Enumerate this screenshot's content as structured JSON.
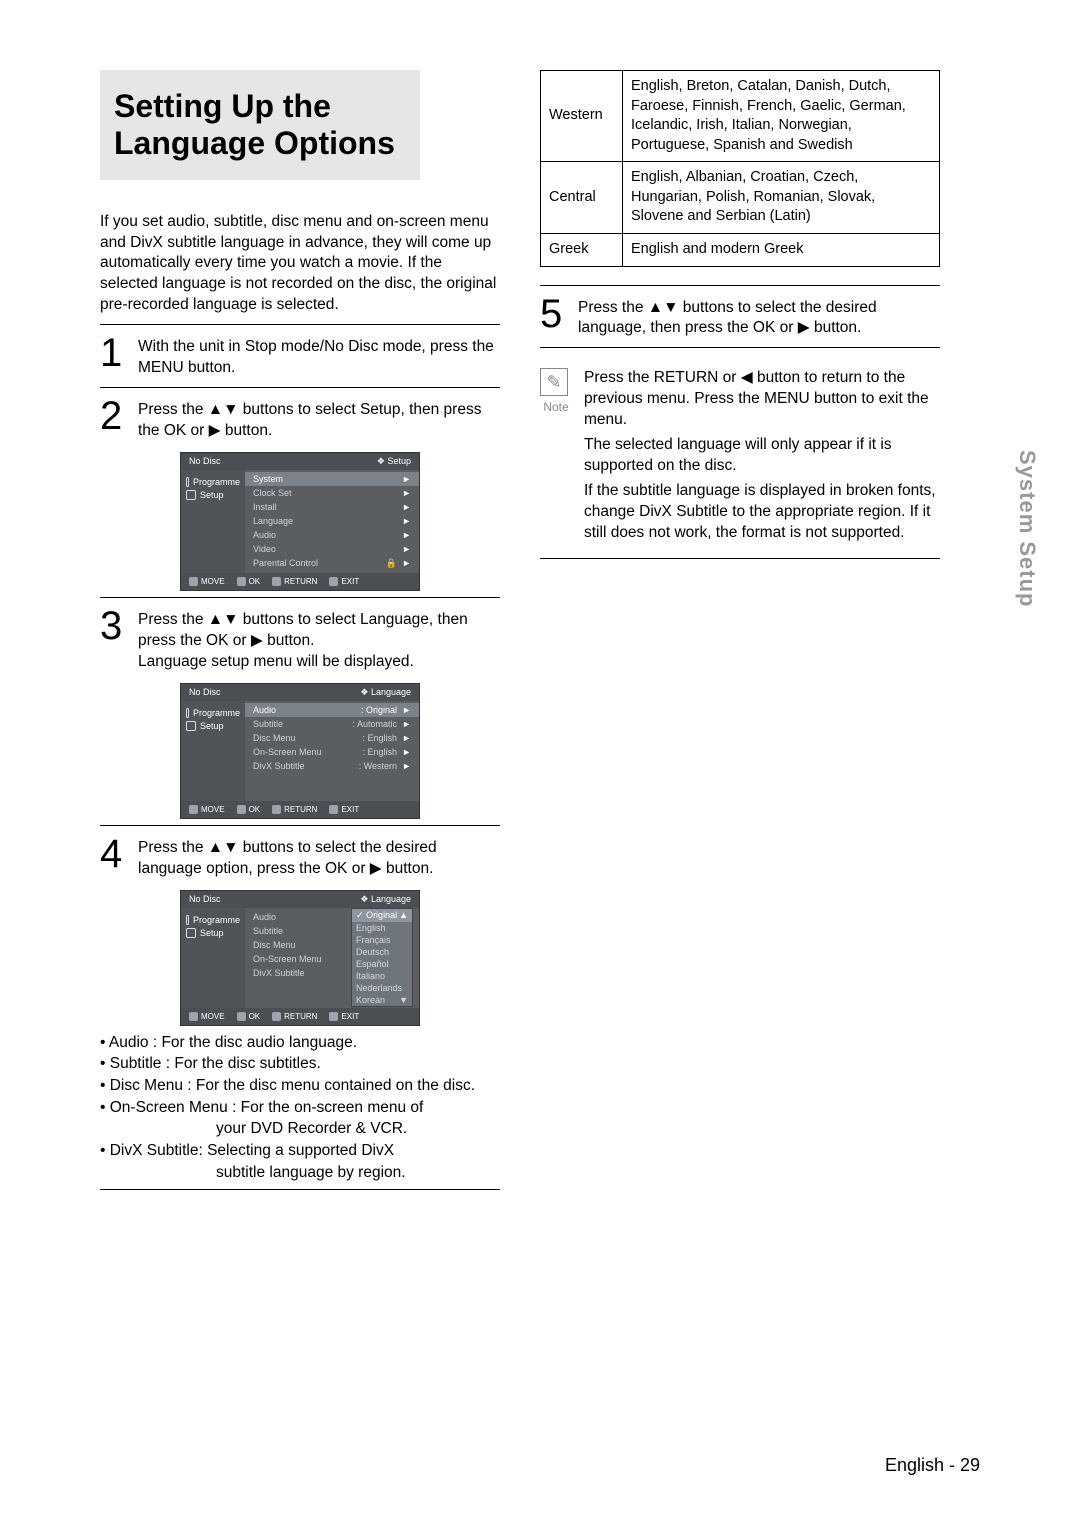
{
  "title": "Setting Up the Language Options",
  "intro": "If you set audio, subtitle, disc menu and on-screen menu and DivX subtitle language in advance, they will come up automatically every time you watch a movie. If the selected language is not recorded on the disc, the original pre-recorded language is selected.",
  "steps": {
    "s1": "With the unit in Stop mode/No Disc mode, press the MENU button.",
    "s2": "Press the ▲▼ buttons to select Setup, then press the OK or ▶ button.",
    "s3a": "Press the ▲▼ buttons to select Language, then press the OK or ▶ button.",
    "s3b": "Language setup menu will be displayed.",
    "s4": "Press the ▲▼ buttons to select the desired language option, press the OK or ▶ button.",
    "s5": "Press the ▲▼ buttons to select the desired language, then press the OK or ▶ button."
  },
  "osd1": {
    "topLeft": "No Disc",
    "topRight": "❖ Setup",
    "side": {
      "programme": "Programme",
      "setup": "Setup"
    },
    "rows": [
      "System",
      "Clock Set",
      "Install",
      "Language",
      "Audio",
      "Video",
      "Parental Control"
    ],
    "lock": "🔒",
    "foot": {
      "move": "MOVE",
      "ok": "OK",
      "return": "RETURN",
      "exit": "EXIT"
    }
  },
  "osd2": {
    "topLeft": "No Disc",
    "topRight": "❖ Language",
    "side": {
      "programme": "Programme",
      "setup": "Setup"
    },
    "rows": [
      {
        "k": "Audio",
        "v": ": Original"
      },
      {
        "k": "Subtitle",
        "v": ": Automatic"
      },
      {
        "k": "Disc Menu",
        "v": ": English"
      },
      {
        "k": "On-Screen Menu",
        "v": ": English"
      },
      {
        "k": "DivX Subtitle",
        "v": ": Western"
      }
    ],
    "foot": {
      "move": "MOVE",
      "ok": "OK",
      "return": "RETURN",
      "exit": "EXIT"
    }
  },
  "osd3": {
    "topLeft": "No Disc",
    "topRight": "❖ Language",
    "side": {
      "programme": "Programme",
      "setup": "Setup"
    },
    "rows": [
      "Audio",
      "Subtitle",
      "Disc Menu",
      "On-Screen Menu",
      "DivX Subtitle"
    ],
    "dd": [
      "Original",
      "English",
      "Français",
      "Deutsch",
      "Español",
      "Italiano",
      "Nederlands",
      "Korean"
    ],
    "foot": {
      "move": "MOVE",
      "ok": "OK",
      "return": "RETURN",
      "exit": "EXIT"
    }
  },
  "bullets": {
    "b1": "• Audio : For the disc audio language.",
    "b2": "• Subtitle : For the disc subtitles.",
    "b3": "• Disc Menu : For the disc menu contained on the disc.",
    "b4": "• On-Screen Menu : For the on-screen menu of",
    "b4s": "your DVD Recorder & VCR.",
    "b5": "• DivX Subtitle:  Selecting a supported DivX",
    "b5s": "subtitle language by region."
  },
  "table": {
    "r1k": "Western",
    "r1v": "English, Breton, Catalan, Danish, Dutch, Faroese, Finnish, French, Gaelic, German, Icelandic, Irish, Italian, Norwegian, Portuguese, Spanish and Swedish",
    "r2k": "Central",
    "r2v": "English, Albanian, Croatian, Czech, Hungarian, Polish, Romanian, Slovak, Slovene and Serbian (Latin)",
    "r3k": "Greek",
    "r3v": "English and modern Greek"
  },
  "note": {
    "label": "Note",
    "p1": "Press the RETURN or ◀ button to return to the previous menu. Press the MENU button to exit the menu.",
    "p2": "The selected language will only appear if it is supported on the disc.",
    "p3": "If the subtitle language is displayed in broken fonts, change DivX Subtitle to the appropriate region. If it still does not work, the format is not supported."
  },
  "sideTab": "System Setup",
  "footer": "English - 29",
  "glyph": {
    "check": "✓",
    "up": "▲",
    "down": "▼",
    "right": "►"
  }
}
